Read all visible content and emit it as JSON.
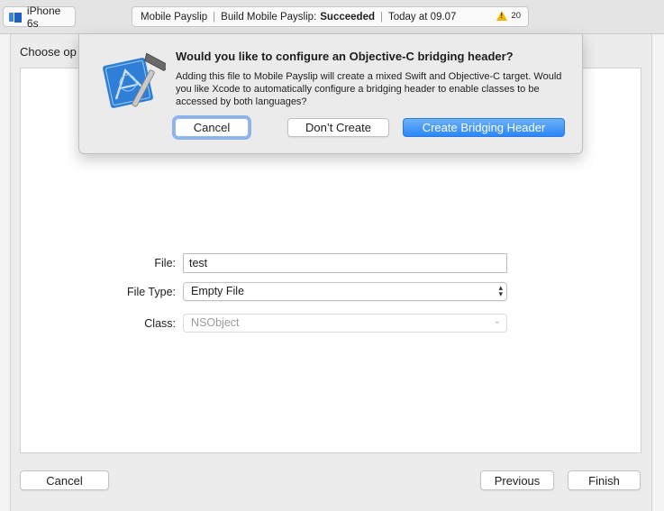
{
  "toolbar": {
    "scheme_device": "iPhone 6s",
    "activity": {
      "project": "Mobile Payslip",
      "build_prefix": "Build Mobile Payslip:",
      "build_status": "Succeeded",
      "time": "Today at 09.07",
      "warning_count": "20"
    }
  },
  "sheet": {
    "title": "Choose op",
    "form": {
      "file_label": "File:",
      "file_value": "test",
      "file_type_label": "File Type:",
      "file_type_value": "Empty File",
      "class_label": "Class:",
      "class_value": "NSObject"
    },
    "buttons": {
      "cancel": "Cancel",
      "previous": "Previous",
      "finish": "Finish"
    }
  },
  "alert": {
    "title": "Would you like to configure an Objective-C bridging header?",
    "body": "Adding this file to Mobile Payslip will create a mixed Swift and Objective-C target. Would you like Xcode to automatically configure a bridging header to enable classes to be accessed by both languages?",
    "buttons": {
      "cancel": "Cancel",
      "dont_create": "Don’t Create",
      "create": "Create Bridging Header"
    }
  },
  "colors": {
    "primary_button": "#2b86f5",
    "focus_ring": "#8cb3ec",
    "warning": "#f2b400",
    "device_icon": "#1e5fbf"
  },
  "icons": [
    "device-icon",
    "warning-icon",
    "xcode-blueprint-hammer-icon",
    "updown-chevron-icon",
    "chevron-down-icon"
  ]
}
